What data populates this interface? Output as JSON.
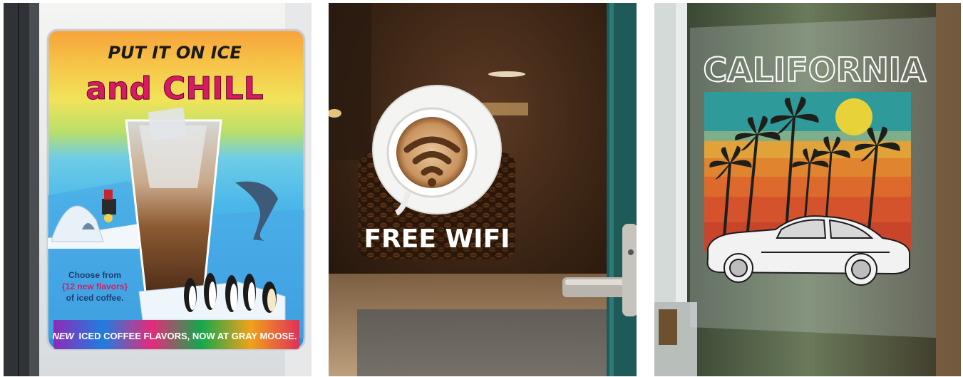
{
  "panels": [
    {
      "name": "iced-coffee-window-sign",
      "headline_top": "PUT IT ON ICE",
      "headline_main": "and CHILL",
      "body_line1": "Choose from",
      "body_line2": "{12 new flavors}",
      "body_line3": "of iced coffee.",
      "banner_lead": "NEW",
      "banner_text": "ICED COFFEE FLAVORS, NOW AT GRAY MOOSE."
    },
    {
      "name": "free-wifi-door-decal",
      "label": "FREE WIFI"
    },
    {
      "name": "california-window-cling",
      "title": "CALIFORNIA"
    }
  ],
  "colors": {
    "headline_pink": "#d81b60",
    "brand_blue": "#1e3b70",
    "wifi_brown": "#5a3418",
    "california_teal": "#2f9a9a"
  }
}
